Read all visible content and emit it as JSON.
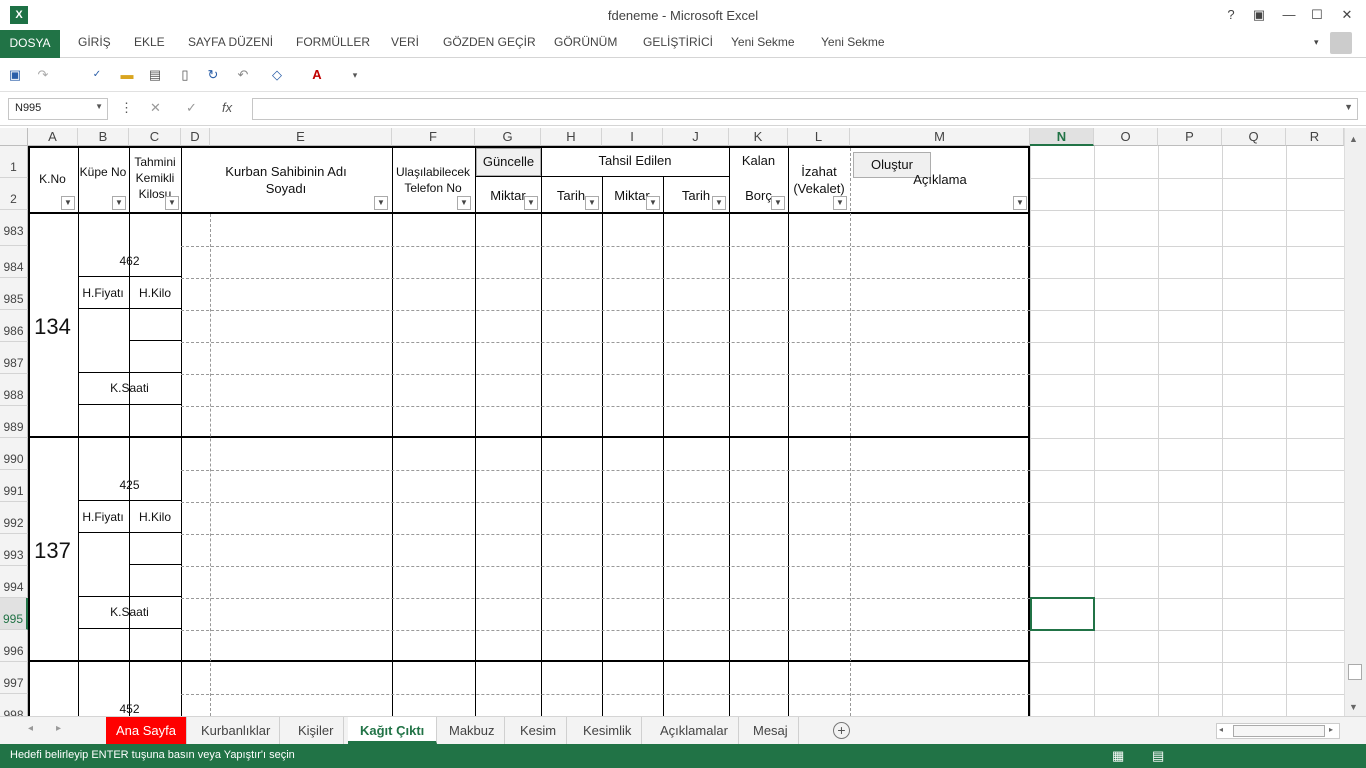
{
  "window": {
    "title": "fdeneme - Microsoft Excel",
    "help": "?",
    "restore": "▣",
    "minimize": "—",
    "maximize": "☐",
    "close": "✕"
  },
  "ribbon": {
    "file": "DOSYA",
    "tabs": [
      "GİRİŞ",
      "EKLE",
      "SAYFA DÜZENİ",
      "FORMÜLLER",
      "VERİ",
      "GÖZDEN GEÇİR",
      "GÖRÜNÜM",
      "GELİŞTİRİCİ",
      "Yeni Sekme",
      "Yeni Sekme"
    ]
  },
  "formula_bar": {
    "name_box": "N995",
    "cancel": "✕",
    "enter": "✓",
    "fx": "fx",
    "value": ""
  },
  "columns": [
    "A",
    "B",
    "C",
    "D",
    "E",
    "F",
    "G",
    "H",
    "I",
    "J",
    "K",
    "L",
    "M",
    "N",
    "O",
    "P",
    "Q",
    "R"
  ],
  "selected_column": "N",
  "rows": [
    "1",
    "2",
    "983",
    "984",
    "985",
    "986",
    "987",
    "988",
    "989",
    "990",
    "991",
    "992",
    "993",
    "994",
    "995",
    "996",
    "997",
    "998"
  ],
  "selected_row": "995",
  "headers": {
    "k_no": "K.No",
    "kupe_no": "Küpe No",
    "tahmini": "Tahmini Kemikli Kilosu",
    "kurban_sahibi": "Kurban Sahibinin Adı Soyadı",
    "telefon": "Ulaşılabilecek Telefon No",
    "guncelle_button": "Güncelle",
    "tahsil_edilen": "Tahsil Edilen",
    "kalan": "Kalan",
    "izahat": "İzahat (Vekalet)",
    "olustur_button": "Oluştur",
    "aciklama": "Açıklama",
    "miktar1": "Miktar",
    "tarih1": "Tarih",
    "miktar2": "Miktar",
    "tarih2": "Tarih",
    "borc": "Borç"
  },
  "blocks": [
    {
      "k_no": "134",
      "kupe": "462",
      "h_fiyati": "H.Fiyatı",
      "h_kilo": "H.Kilo",
      "k_saati": "K.Saati"
    },
    {
      "k_no": "137",
      "kupe": "425",
      "h_fiyati": "H.Fiyatı",
      "h_kilo": "H.Kilo",
      "k_saati": "K.Saati"
    },
    {
      "kupe": "452"
    }
  ],
  "sheet_tabs": [
    "Ana Sayfa",
    "Kurbanlıklar",
    "Kişiler",
    "Kağıt Çıktı",
    "Makbuz",
    "Kesim",
    "Kesimlik",
    "Açıklamalar",
    "Mesaj"
  ],
  "active_sheet": "Kağıt Çıktı",
  "status": {
    "message": "Hedefi belirleyip ENTER tuşuna basın veya Yapıştır'ı seçin"
  },
  "colors": {
    "excel_green": "#217346",
    "red_tab": "#ff0000"
  }
}
